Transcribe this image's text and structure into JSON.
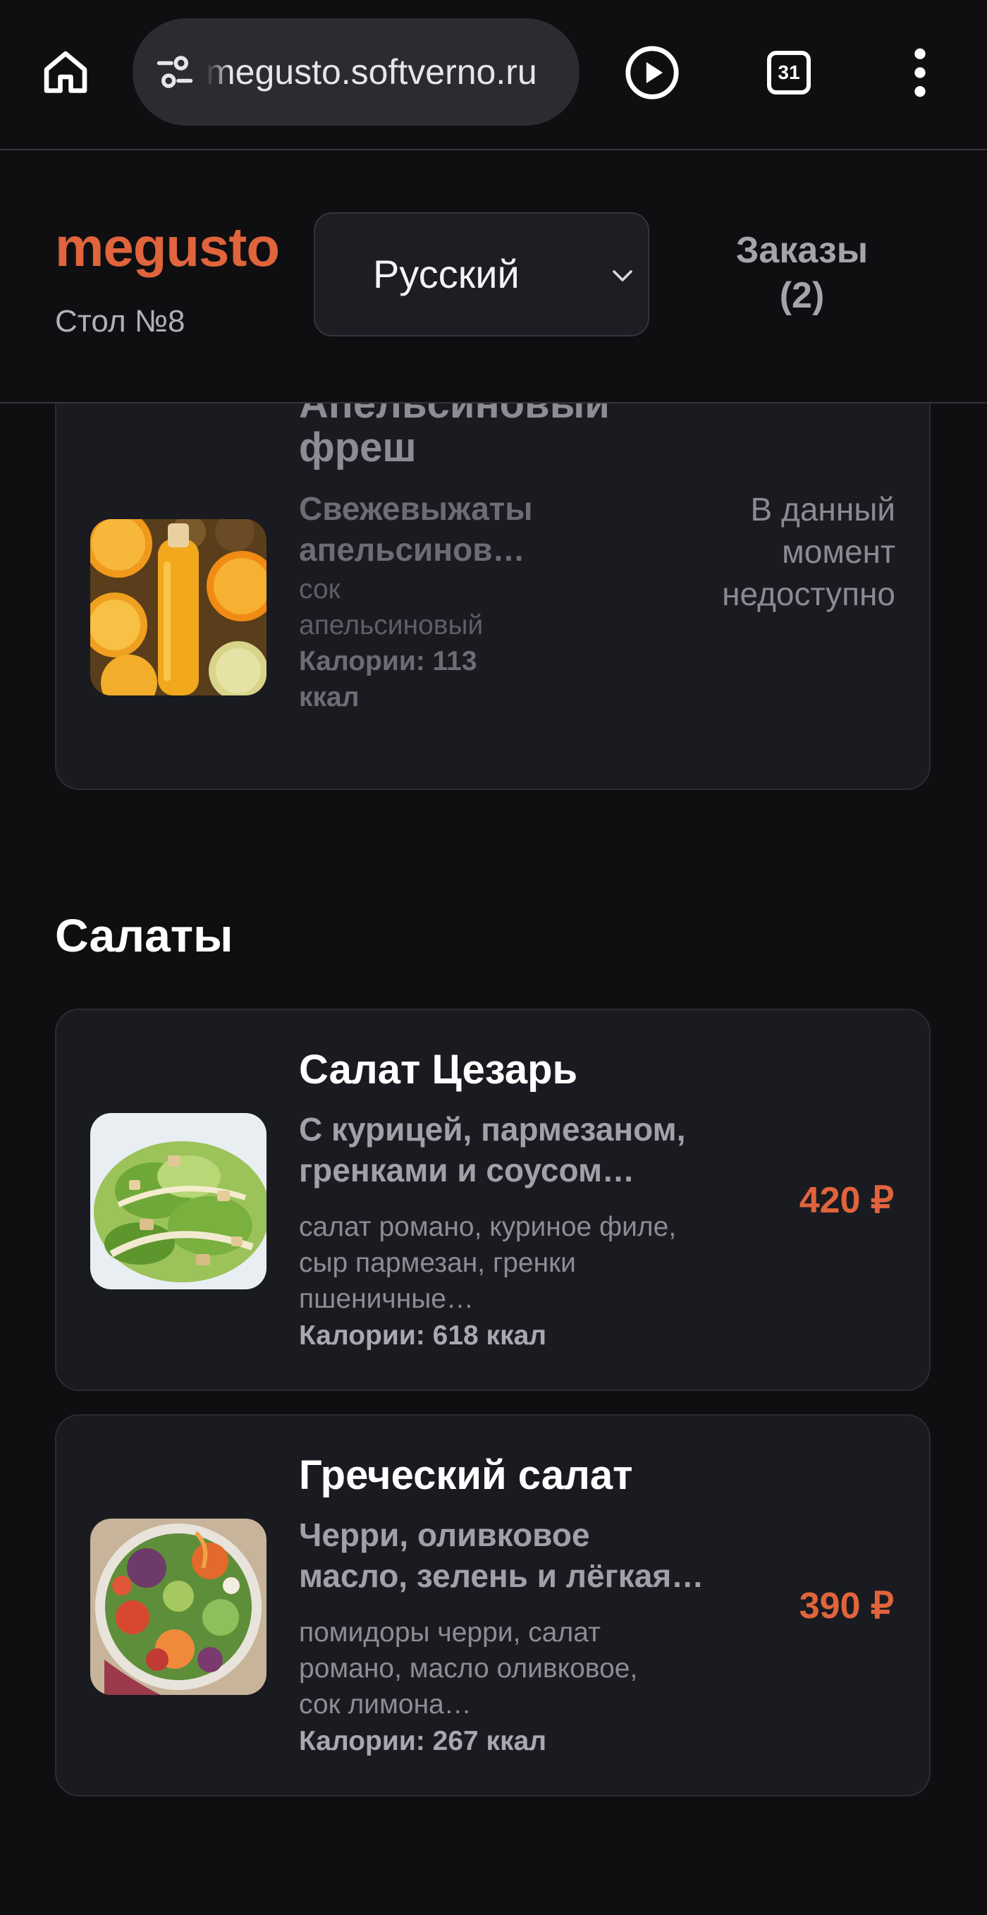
{
  "browser": {
    "url": "megusto.softverno.ru",
    "tab_count": "31",
    "icons": [
      "home-icon",
      "tune-icon",
      "play-icon",
      "tabs-icon",
      "more-vert-icon"
    ]
  },
  "header": {
    "brand": "megusto",
    "table": "Стол №8",
    "language": "Русский",
    "orders_label": "Заказы",
    "orders_count": "(2)"
  },
  "colors": {
    "accent": "#e0643c",
    "background": "#0f0f11",
    "card": "#1a1b20"
  },
  "items": [
    {
      "name_line1": "Апельсиновый",
      "name_line2": "фреш",
      "desc_line1": "Свежевыжаты",
      "desc_line2": "апельсинов…",
      "ingr_line1": "сок",
      "ingr_line2": "апельсиновый",
      "cal_line1": "Калории: 113",
      "cal_line2": "ккал",
      "status_line1": "В данный",
      "status_line2": "момент",
      "status_line3": "недоступно"
    },
    {
      "name": "Салат Цезарь",
      "desc_line1": "С курицей, пармезаном,",
      "desc_line2": "гренками и соусом…",
      "ingr_line1": "салат романо, куриное филе,",
      "ingr_line2": "сыр пармезан, гренки",
      "ingr_line3": "пшеничные…",
      "calories": "Калории: 618 ккал",
      "price": "420 ₽"
    },
    {
      "name": "Греческий салат",
      "desc_line1": "Черри, оливковое",
      "desc_line2": "масло, зелень и лёгкая…",
      "ingr_line1": "помидоры черри, салат",
      "ingr_line2": "романо, масло оливковое,",
      "ingr_line3": "сок лимона…",
      "calories": "Калории: 267 ккал",
      "price": "390 ₽"
    }
  ],
  "sections": {
    "salads": "Салаты"
  }
}
